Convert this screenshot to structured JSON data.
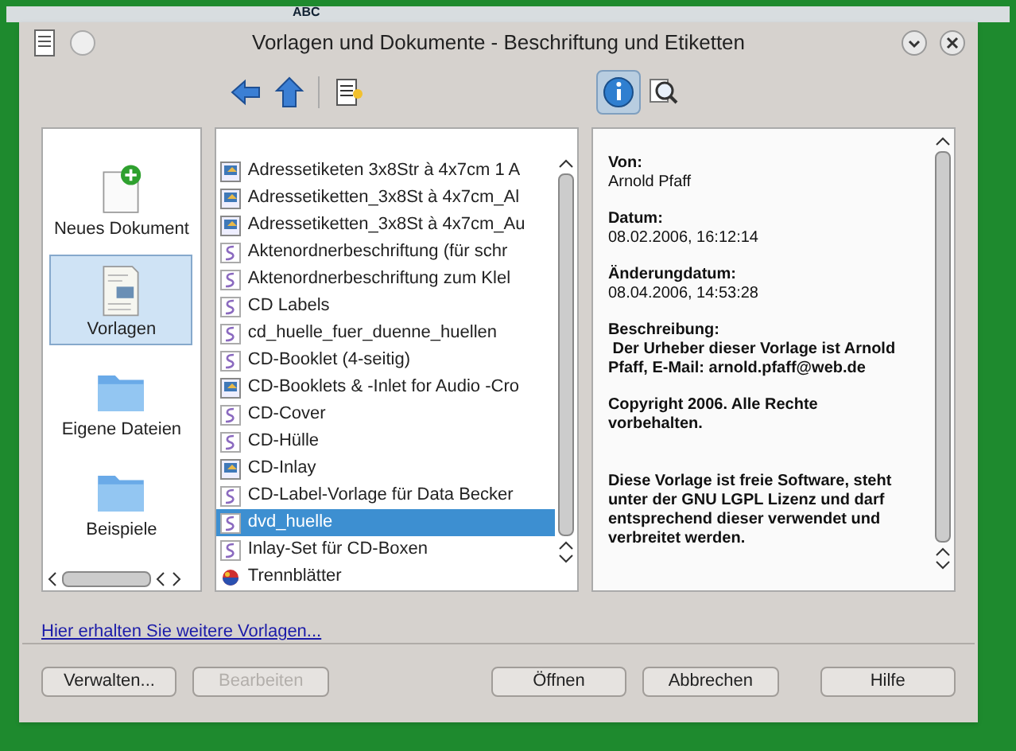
{
  "background_toolbar": {
    "label": "ABC"
  },
  "window": {
    "title": "Vorlagen und Dokumente - Beschriftung und Etiketten"
  },
  "toolbar": [
    {
      "kind": "back",
      "selected": false
    },
    {
      "kind": "up",
      "selected": false
    },
    {
      "kind": "print",
      "selected": false
    },
    {
      "kind": "info",
      "selected": true
    },
    {
      "kind": "preview",
      "selected": false
    }
  ],
  "sidebar": {
    "items": [
      {
        "label": "Neues Dokument",
        "kind": "new",
        "selected": false
      },
      {
        "label": "Vorlagen",
        "kind": "templates",
        "selected": true
      },
      {
        "label": "Eigene Dateien",
        "kind": "folder",
        "selected": false
      },
      {
        "label": "Beispiele",
        "kind": "folder",
        "selected": false
      }
    ]
  },
  "list": {
    "items": [
      {
        "label": "Adressetiketen 3x8Str à 4x7cm 1 A",
        "kind": "image",
        "selected": false
      },
      {
        "label": "Adressetiketten_3x8St à 4x7cm_Al",
        "kind": "image",
        "selected": false
      },
      {
        "label": "Adressetiketten_3x8St à 4x7cm_Au",
        "kind": "image",
        "selected": false
      },
      {
        "label": "Aktenordnerbeschriftung (für schr",
        "kind": "draw",
        "selected": false
      },
      {
        "label": "Aktenordnerbeschriftung zum Klel",
        "kind": "draw",
        "selected": false
      },
      {
        "label": "CD Labels",
        "kind": "draw",
        "selected": false
      },
      {
        "label": "cd_huelle_fuer_duenne_huellen",
        "kind": "draw",
        "selected": false
      },
      {
        "label": "CD-Booklet (4-seitig)",
        "kind": "draw",
        "selected": false
      },
      {
        "label": "CD-Booklets & -Inlet for Audio -Cro",
        "kind": "image",
        "selected": false
      },
      {
        "label": "CD-Cover",
        "kind": "draw",
        "selected": false
      },
      {
        "label": "CD-Hülle",
        "kind": "draw",
        "selected": false
      },
      {
        "label": "CD-Inlay",
        "kind": "image",
        "selected": false
      },
      {
        "label": "CD-Label-Vorlage für Data Becker",
        "kind": "draw",
        "selected": false
      },
      {
        "label": "dvd_huelle",
        "kind": "draw",
        "selected": true
      },
      {
        "label": "Inlay-Set für CD-Boxen",
        "kind": "draw",
        "selected": false
      },
      {
        "label": "Trennblätter",
        "kind": "ball",
        "selected": false
      }
    ]
  },
  "info": {
    "fields": [
      {
        "label": "Von:",
        "value": "Arnold Pfaff",
        "kind": "plain"
      },
      {
        "label": "Datum:",
        "value": "08.02.2006, 16:12:14",
        "kind": "plain"
      },
      {
        "label": "Änderungdatum:",
        "value": "08.04.2006, 14:53:28",
        "kind": "plain"
      },
      {
        "label": "Beschreibung:",
        "value": " Der Urheber dieser Vorlage ist Arnold Pfaff, E-Mail: arnold.pfaff@web.de",
        "kind": "bold"
      }
    ],
    "paragraphs": [
      "Copyright 2006. Alle Rechte vorbehalten.",
      "Diese Vorlage ist freie Software, steht unter der GNU LGPL Lizenz und darf entsprechend dieser verwendet und verbreitet werden."
    ]
  },
  "link": "Hier erhalten Sie weitere Vorlagen...",
  "buttons": [
    {
      "label": "Verwalten...",
      "disabled": false
    },
    {
      "label": "Bearbeiten",
      "disabled": true
    },
    {
      "label": "Öffnen",
      "disabled": false
    },
    {
      "label": "Abbrechen",
      "disabled": false
    },
    {
      "label": "Hilfe",
      "disabled": false
    }
  ]
}
